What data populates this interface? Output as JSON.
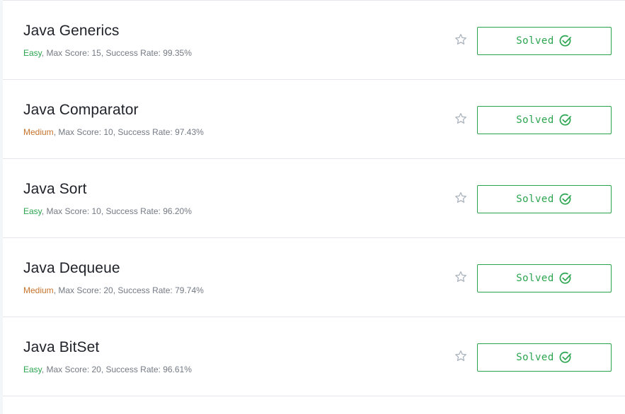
{
  "challenges": [
    {
      "title": "Java Generics",
      "difficulty": "Easy",
      "difficulty_level": "easy",
      "details": ", Max Score: 15, Success Rate: 99.35%",
      "status_label": "Solved"
    },
    {
      "title": "Java Comparator",
      "difficulty": "Medium",
      "difficulty_level": "medium",
      "details": ", Max Score: 10, Success Rate: 97.43%",
      "status_label": "Solved"
    },
    {
      "title": "Java Sort",
      "difficulty": "Easy",
      "difficulty_level": "easy",
      "details": ", Max Score: 10, Success Rate: 96.20%",
      "status_label": "Solved"
    },
    {
      "title": "Java Dequeue",
      "difficulty": "Medium",
      "difficulty_level": "medium",
      "details": ", Max Score: 20, Success Rate: 79.74%",
      "status_label": "Solved"
    },
    {
      "title": "Java BitSet",
      "difficulty": "Easy",
      "difficulty_level": "easy",
      "details": ", Max Score: 20, Success Rate: 96.61%",
      "status_label": "Solved"
    }
  ],
  "colors": {
    "easy": "#2ba44f",
    "medium": "#c7732c",
    "solved": "#2ba44f",
    "star_outline": "#a9b2bb"
  },
  "icons": {
    "star": "star-outline-icon",
    "check": "check-circle-icon"
  }
}
